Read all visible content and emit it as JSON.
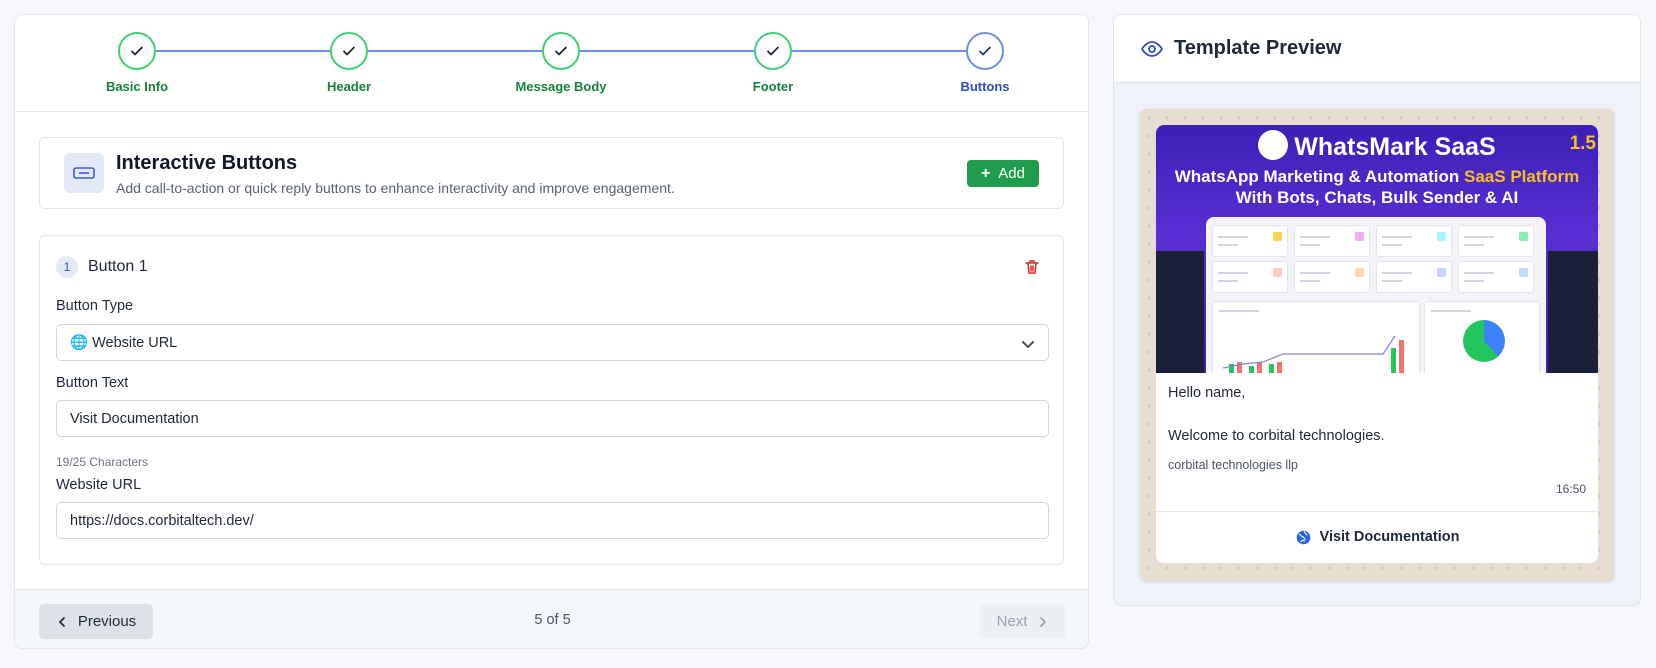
{
  "stepper": {
    "steps": [
      {
        "label": "Basic Info",
        "state": "complete"
      },
      {
        "label": "Header",
        "state": "complete"
      },
      {
        "label": "Message Body",
        "state": "complete"
      },
      {
        "label": "Footer",
        "state": "complete"
      },
      {
        "label": "Buttons",
        "state": "active"
      }
    ]
  },
  "section": {
    "title": "Interactive Buttons",
    "subtitle": "Add call-to-action or quick reply buttons to enhance interactivity and improve engagement.",
    "add_label": "Add",
    "add_icon": "plus-icon"
  },
  "button_item": {
    "number": "1",
    "title": "Button 1",
    "type_label": "Button Type",
    "type_value": "🌐 Website URL",
    "text_label": "Button Text",
    "text_value": "Visit Documentation",
    "char_hint": "19/25 Characters",
    "url_label": "Website URL",
    "url_value": "https://docs.corbitaltech.dev/"
  },
  "footer": {
    "previous_label": "Previous",
    "page_count": "5 of 5",
    "next_label": "Next"
  },
  "preview": {
    "title": "Template Preview",
    "banner": {
      "title": "WhatsMark SaaS",
      "version": "1.5",
      "line1_a": "WhatsApp Marketing & Automation ",
      "line1_b": "SaaS Platform",
      "line2": "With Bots, Chats, Bulk Sender & AI"
    },
    "message": {
      "greeting": "Hello name,",
      "body": "Welcome to corbital technologies.",
      "footer": "corbital technologies llp",
      "time": "16:50",
      "cta_label": "Visit Documentation"
    }
  },
  "colors": {
    "accent_green": "#1f9d4c",
    "step_complete": "#3ecf72",
    "step_active": "#6c8fe8",
    "delete_red": "#dc2626"
  }
}
